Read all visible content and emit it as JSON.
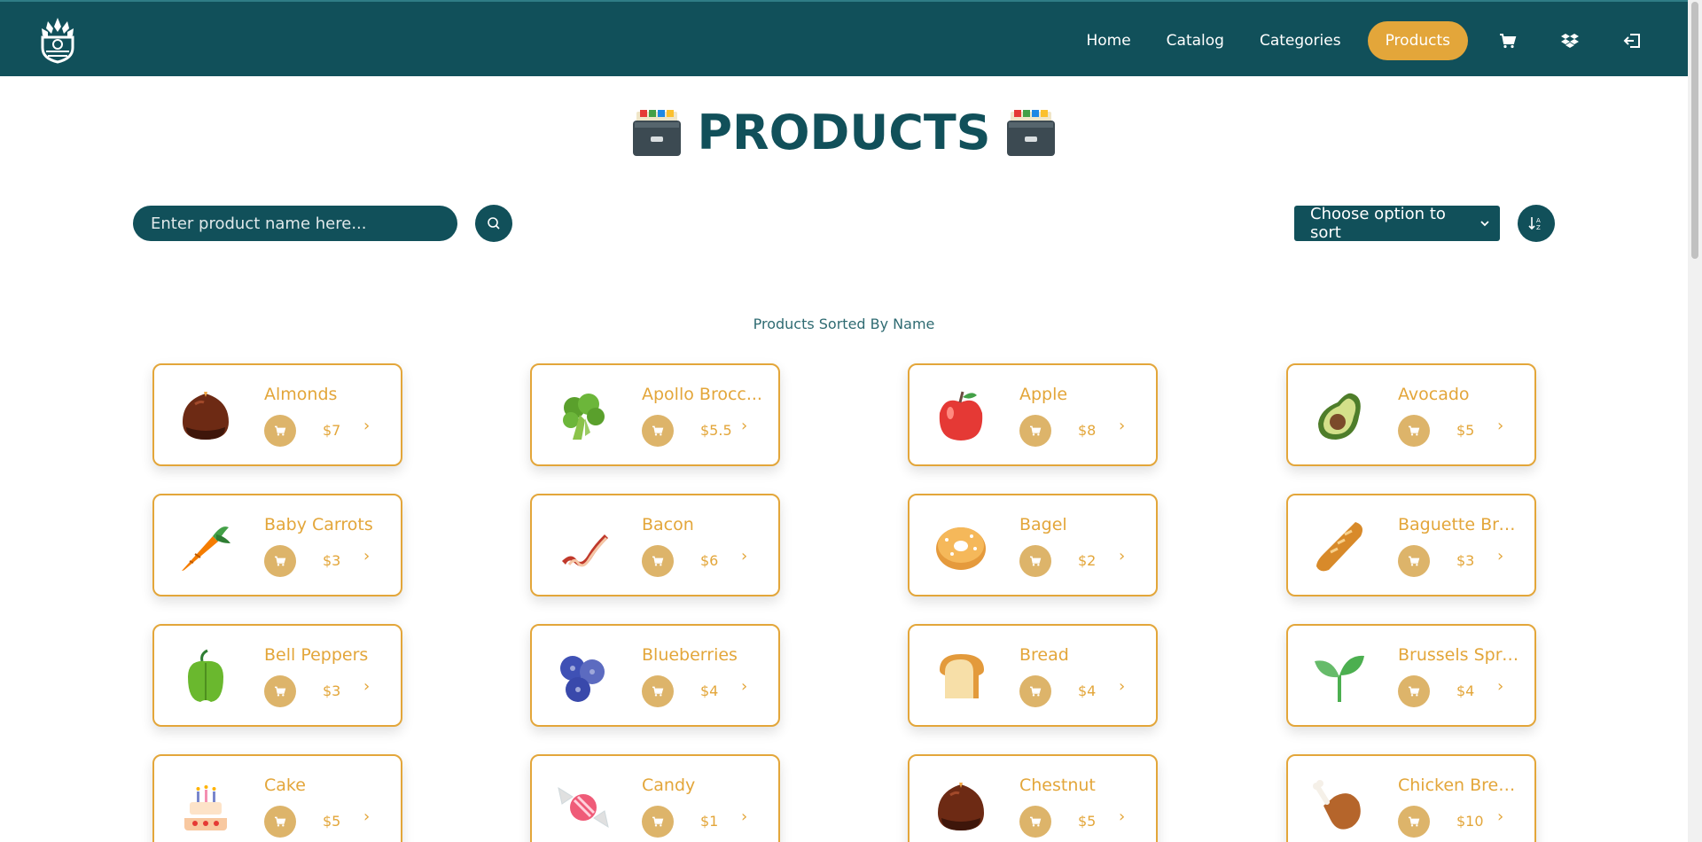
{
  "nav": {
    "logo_icon": "plant-shield-logo",
    "links": [
      {
        "label": "Home",
        "active": false
      },
      {
        "label": "Catalog",
        "active": false
      },
      {
        "label": "Categories",
        "active": false
      },
      {
        "label": "Products",
        "active": true
      }
    ],
    "icons": [
      "cart-icon",
      "dropbox-icon",
      "logout-icon"
    ]
  },
  "page": {
    "title": "PRODUCTS",
    "title_emoji": "card-file-box-emoji"
  },
  "search": {
    "placeholder": "Enter product name here...",
    "value": ""
  },
  "sort": {
    "selected": "Choose option to sort",
    "button_icon": "sort-az-icon"
  },
  "sorted_label": "Products Sorted By Name",
  "colors": {
    "primary": "#11505a",
    "accent": "#e3a63a",
    "cart_button": "#ddb46a"
  },
  "products": [
    {
      "name": "Almonds",
      "price": "$7",
      "icon": "chestnut-emoji"
    },
    {
      "name": "Apollo Brocc...",
      "price": "$5.5",
      "icon": "broccoli-emoji"
    },
    {
      "name": "Apple",
      "price": "$8",
      "icon": "red-apple-emoji"
    },
    {
      "name": "Avocado",
      "price": "$5",
      "icon": "avocado-emoji"
    },
    {
      "name": "Baby Carrots",
      "price": "$3",
      "icon": "carrot-emoji"
    },
    {
      "name": "Bacon",
      "price": "$6",
      "icon": "bacon-emoji"
    },
    {
      "name": "Bagel",
      "price": "$2",
      "icon": "bagel-emoji"
    },
    {
      "name": "Baguette Bre...",
      "price": "$3",
      "icon": "baguette-emoji"
    },
    {
      "name": "Bell Peppers",
      "price": "$3",
      "icon": "bell-pepper-emoji"
    },
    {
      "name": "Blueberries",
      "price": "$4",
      "icon": "blueberries-emoji"
    },
    {
      "name": "Bread",
      "price": "$4",
      "icon": "bread-emoji"
    },
    {
      "name": "Brussels Spro...",
      "price": "$4",
      "icon": "seedling-emoji"
    },
    {
      "name": "Cake",
      "price": "$5",
      "icon": "birthday-cake-emoji"
    },
    {
      "name": "Candy",
      "price": "$1",
      "icon": "candy-emoji"
    },
    {
      "name": "Chestnut",
      "price": "$5",
      "icon": "chestnut-emoji"
    },
    {
      "name": "Chicken Brea...",
      "price": "$10",
      "icon": "poultry-leg-emoji"
    }
  ]
}
